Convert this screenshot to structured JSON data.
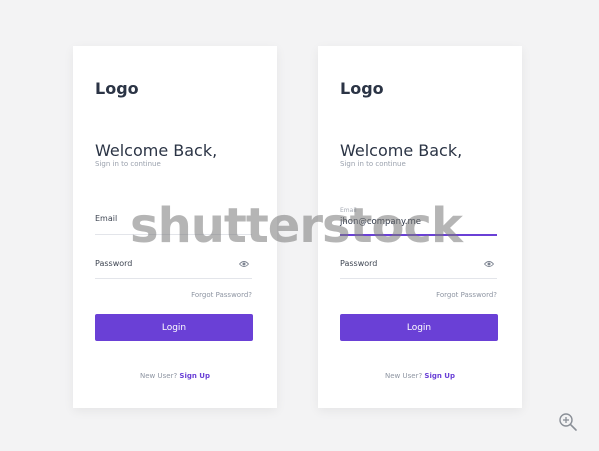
{
  "cards": [
    {
      "logo": "Logo",
      "title": "Welcome Back,",
      "subtitle": "Sign in to continue",
      "email_label": "Email",
      "password_label": "Password",
      "forgot": "Forgot Password?",
      "login": "Login",
      "new_user": "New User?",
      "sign_up": "Sign Up"
    },
    {
      "logo": "Logo",
      "title": "Welcome Back,",
      "subtitle": "Sign in to continue",
      "email_label": "Email",
      "email_value": "jhon@company.me",
      "password_label": "Password",
      "forgot": "Forgot Password?",
      "login": "Login",
      "new_user": "New User?",
      "sign_up": "Sign Up"
    }
  ],
  "watermark": "shutterstock",
  "icons": {
    "eye": "eye-icon",
    "zoom": "zoom-in-icon"
  },
  "colors": {
    "accent": "#6a40d6",
    "text_dark": "#2b3445",
    "background": "#f3f3f4"
  }
}
